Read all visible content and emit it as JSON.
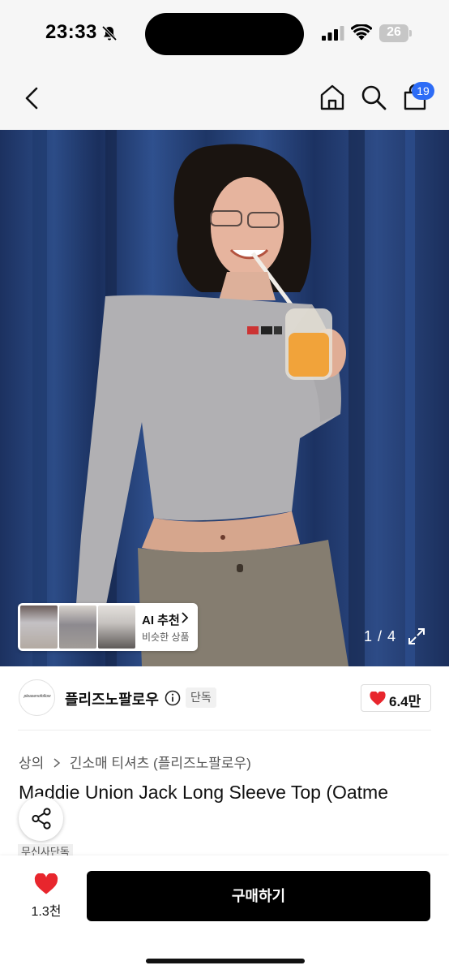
{
  "status_bar": {
    "time": "23:33",
    "battery": "26"
  },
  "nav": {
    "cart_count": "19"
  },
  "gallery": {
    "page_indicator": "1 / 4",
    "ai_card": {
      "title": "AI 추천",
      "subtitle": "비슷한 상품"
    }
  },
  "brand": {
    "logo_text": "pleasenofollow",
    "name": "플리즈노팔로우",
    "exclusive_badge": "단독",
    "likes": "6.4만"
  },
  "breadcrumb": {
    "items": [
      "상의",
      "긴소매 티셔츠 (플리즈노팔로우)"
    ]
  },
  "product": {
    "title": "Maddie Union Jack Long Sleeve Top (Oatme",
    "tag": "무신사단독"
  },
  "bottom_bar": {
    "wish_count": "1.3천",
    "buy_label": "구매하기"
  },
  "colors": {
    "badge_blue": "#2d6cf6",
    "heart_red": "#e8262d",
    "buy_button": "#000000"
  }
}
